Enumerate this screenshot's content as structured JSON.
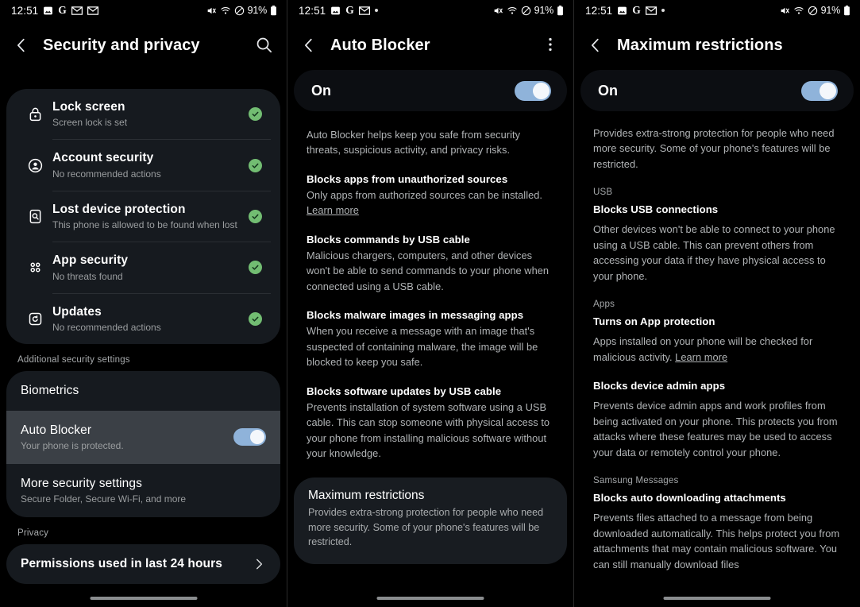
{
  "status_bar": {
    "time": "12:51",
    "left_icons": [
      "photos-icon",
      "google-icon",
      "gmail-icon",
      "gmail-icon"
    ],
    "left_icons_p2": [
      "photos-icon",
      "google-icon",
      "gmail-icon",
      "dot-indicator"
    ],
    "right_icons": [
      "mute-icon",
      "wifi-icon",
      "do-not-disturb-icon"
    ],
    "battery": "91%"
  },
  "colors": {
    "accent_toggle": "#8fb3da",
    "status_ok": "#72bd72",
    "card_bg": "#161a1f",
    "highlight_row": "#3b4046",
    "page_bg": "#000000"
  },
  "panel1": {
    "title": "Security and privacy",
    "search_icon": "search-icon",
    "back_icon": "back-chevron-icon",
    "status_items": [
      {
        "icon": "lock-icon",
        "title": "Lock screen",
        "subtitle": "Screen lock is set",
        "status": "ok"
      },
      {
        "icon": "account-icon",
        "title": "Account security",
        "subtitle": "No recommended actions",
        "status": "ok"
      },
      {
        "icon": "lost-device-icon",
        "title": "Lost device protection",
        "subtitle": "This phone is allowed to be found when lost",
        "status": "ok"
      },
      {
        "icon": "apps-grid-icon",
        "title": "App security",
        "subtitle": "No threats found",
        "status": "ok"
      },
      {
        "icon": "update-icon",
        "title": "Updates",
        "subtitle": "No recommended actions",
        "status": "ok"
      }
    ],
    "section_additional": "Additional security settings",
    "biometrics": {
      "title": "Biometrics"
    },
    "auto_blocker": {
      "title": "Auto Blocker",
      "subtitle": "Your phone is protected.",
      "toggle_on": true
    },
    "more_security": {
      "title": "More security settings",
      "subtitle": "Secure Folder, Secure Wi-Fi, and more"
    },
    "section_privacy": "Privacy",
    "permissions": {
      "title": "Permissions used in last 24 hours",
      "chevron": "chevron-right-icon"
    }
  },
  "panel2": {
    "title": "Auto Blocker",
    "back_icon": "back-chevron-icon",
    "overflow_icon": "more-options-icon",
    "toggle_label": "On",
    "toggle_on": true,
    "intro": "Auto Blocker helps keep you safe from security threats, suspicious activity, and privacy risks.",
    "features": [
      {
        "title": "Blocks apps from unauthorized sources",
        "body": "Only apps from authorized sources can be installed. ",
        "link": "Learn more"
      },
      {
        "title": "Blocks commands by USB cable",
        "body": "Malicious chargers, computers, and other devices won't be able to send commands to your phone when connected using a USB cable.",
        "link": ""
      },
      {
        "title": "Blocks malware images in messaging apps",
        "body": "When you receive a message with an image that's suspected of containing malware, the image will be blocked to keep you safe.",
        "link": ""
      },
      {
        "title": "Blocks software updates by USB cable",
        "body": "Prevents installation of system software using a USB cable. This can stop someone with physical access to your phone from installing malicious software without your knowledge.",
        "link": ""
      }
    ],
    "max_restrictions": {
      "title": "Maximum restrictions",
      "body": "Provides extra-strong protection for people who need more security. Some of your phone's features will be restricted."
    }
  },
  "panel3": {
    "title": "Maximum restrictions",
    "back_icon": "back-chevron-icon",
    "toggle_label": "On",
    "toggle_on": true,
    "intro": "Provides extra-strong protection for people who need more security. Some of your phone's features will be restricted.",
    "groups": [
      {
        "category": "USB",
        "items": [
          {
            "title": "Blocks USB connections",
            "body": "Other devices won't be able to connect to your phone using a USB cable. This can prevent others from accessing your data if they have physical access to your phone.",
            "link": ""
          }
        ]
      },
      {
        "category": "Apps",
        "items": [
          {
            "title": "Turns on App protection",
            "body": "Apps installed on your phone will be checked for malicious activity. ",
            "link": "Learn more"
          },
          {
            "title": "Blocks device admin apps",
            "body": "Prevents device admin apps and work profiles from being activated on your phone. This protects you from attacks where these features may be used to access your data or remotely control your phone.",
            "link": ""
          }
        ]
      },
      {
        "category": "Samsung Messages",
        "items": [
          {
            "title": "Blocks auto downloading attachments",
            "body": "Prevents files attached to a message from being downloaded automatically. This helps protect you from attachments that may contain malicious software. You can still manually download files",
            "link": ""
          }
        ]
      }
    ]
  }
}
